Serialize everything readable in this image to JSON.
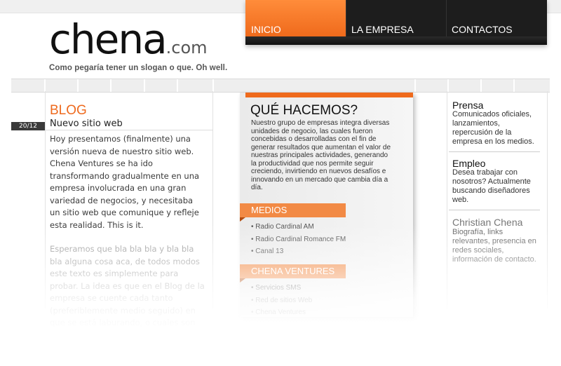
{
  "logo": {
    "name": "chena",
    "domain": ".com",
    "slogan": "Como pegaría tener un slogan o que. Oh well."
  },
  "nav": {
    "items": [
      {
        "label": "INICIO",
        "active": true
      },
      {
        "label": "LA EMPRESA",
        "active": false
      },
      {
        "label": "CONTACTOS",
        "active": false
      }
    ]
  },
  "blog": {
    "heading": "BLOG",
    "post": {
      "date": "20/12",
      "title": "Nuevo sitio web",
      "paragraph1": "Hoy presentamos (finalmente) una versión nueva de nuestro sitio web. Chena Ventures se ha ido transformando gradualmente en una empresa involucrada en una gran variedad de negocios, y necesitaba un sitio web que comunique y refleje esta realidad. This is it.",
      "paragraph2": "Esperamos que bla bla bla y bla bla bla alguna cosa aca, de todos modos este texto es simplemente para probar. La idea es que en el Blog de la empresa se cuente cada tanto (preferiblemente medio seguido) en que se está laburando, o cuales son los productos nuevos o que se yo. Información"
    }
  },
  "que_hacemos": {
    "title": "QUÉ HACEMOS?",
    "text": "Nuestro grupo de empresas integra diversas unidades de negocio, las cuales fueron concebidas o desarrolladas con el fin de generar resultados que aumentan el valor de nuestras principales actividades, generando la productividad que nos permite seguir creciendo, invirtiendo en nuevos desafíos e innovando en un mercado que cambia día a día.",
    "medios": {
      "heading": "MEDIOS",
      "items": [
        "• Radio Cardinal AM",
        "• Radio Cardinal Romance FM",
        "• Canal 13"
      ]
    },
    "chena_ventures": {
      "heading": "CHENA VENTURES",
      "items": [
        "• Servicios SMS",
        "• Red de sitios Web",
        "• Chena Ventures"
      ]
    }
  },
  "sidebar": {
    "prensa": {
      "title": "Prensa",
      "text": "Comunicados oficiales, lanzamientos, repercusión de la empresa en los medios."
    },
    "empleo": {
      "title": "Empleo",
      "text": "Desea trabajar con nosotros? Actualmente buscando diseñadores web."
    },
    "christian": {
      "title": "Christian Chena",
      "text": "Biografía, links relevantes, presencia en redes sociales, información de contacto."
    }
  },
  "colors": {
    "accent": "#ef6a1c",
    "dark": "#1d1d1d",
    "grid": "#eeeeee"
  }
}
